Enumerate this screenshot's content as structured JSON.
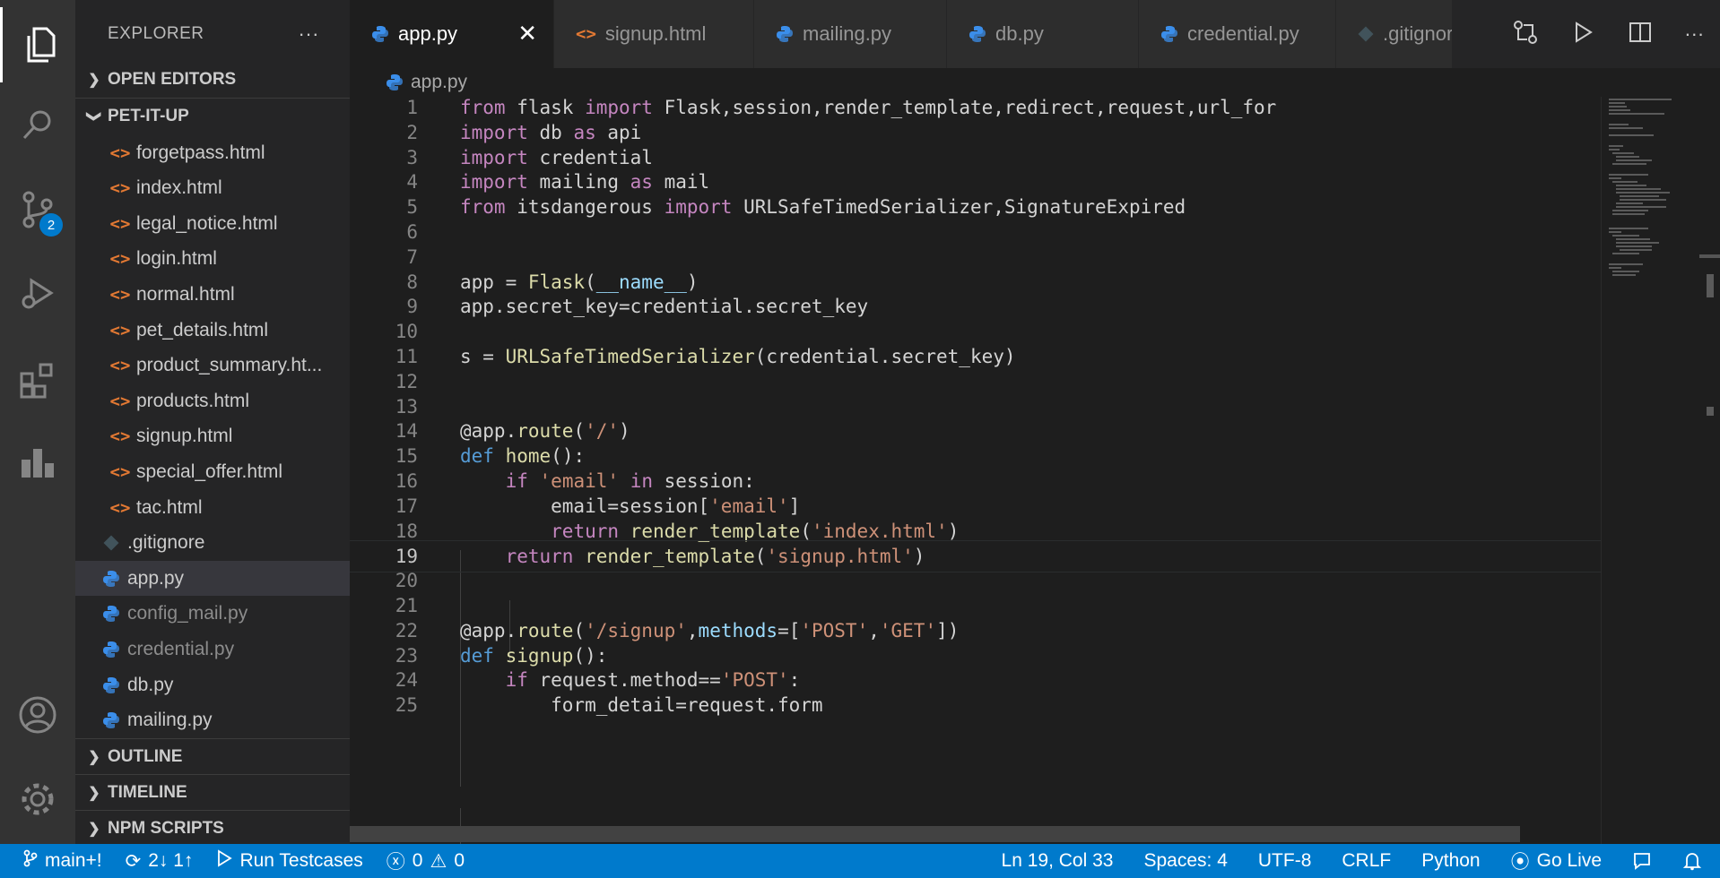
{
  "activity_bar": {
    "scm_badge": "2"
  },
  "sidebar": {
    "title": "EXPLORER",
    "more_label": "···",
    "sections": {
      "open_editors": "OPEN EDITORS",
      "project": "PET-IT-UP",
      "outline": "OUTLINE",
      "timeline": "TIMELINE",
      "npm_scripts": "NPM SCRIPTS"
    },
    "files": [
      {
        "name": "forgetpass.html",
        "icon": "html-icon"
      },
      {
        "name": "index.html",
        "icon": "html-icon"
      },
      {
        "name": "legal_notice.html",
        "icon": "html-icon"
      },
      {
        "name": "login.html",
        "icon": "html-icon"
      },
      {
        "name": "normal.html",
        "icon": "html-icon"
      },
      {
        "name": "pet_details.html",
        "icon": "html-icon"
      },
      {
        "name": "product_summary.ht...",
        "icon": "html-icon"
      },
      {
        "name": "products.html",
        "icon": "html-icon"
      },
      {
        "name": "signup.html",
        "icon": "html-icon"
      },
      {
        "name": "special_offer.html",
        "icon": "html-icon"
      },
      {
        "name": "tac.html",
        "icon": "html-icon"
      },
      {
        "name": ".gitignore",
        "icon": "git-icon"
      },
      {
        "name": "app.py",
        "icon": "python-icon",
        "selected": true
      },
      {
        "name": "config_mail.py",
        "icon": "python-icon",
        "dim": true
      },
      {
        "name": "credential.py",
        "icon": "python-icon",
        "dim": true
      },
      {
        "name": "db.py",
        "icon": "python-icon"
      },
      {
        "name": "mailing.py",
        "icon": "python-icon"
      }
    ]
  },
  "tabs": [
    {
      "label": "app.py",
      "icon": "python-icon",
      "active": true
    },
    {
      "label": "signup.html",
      "icon": "html-icon"
    },
    {
      "label": "mailing.py",
      "icon": "python-icon"
    },
    {
      "label": "db.py",
      "icon": "python-icon"
    },
    {
      "label": "credential.py",
      "icon": "python-icon"
    },
    {
      "label": ".gitignore",
      "icon": "git-icon"
    }
  ],
  "breadcrumb": "app.py",
  "editor": {
    "current_line": 19,
    "lines": [
      {
        "n": "1",
        "text": "from flask import Flask,session,render_template,redirect,request,url_for"
      },
      {
        "n": "2",
        "text": "import db as api"
      },
      {
        "n": "3",
        "text": "import credential"
      },
      {
        "n": "4",
        "text": "import mailing as mail"
      },
      {
        "n": "5",
        "text": "from itsdangerous import URLSafeTimedSerializer,SignatureExpired"
      },
      {
        "n": "6",
        "text": ""
      },
      {
        "n": "7",
        "text": ""
      },
      {
        "n": "8",
        "text": "app = Flask(__name__)"
      },
      {
        "n": "9",
        "text": "app.secret_key=credential.secret_key"
      },
      {
        "n": "10",
        "text": ""
      },
      {
        "n": "11",
        "text": "s = URLSafeTimedSerializer(credential.secret_key)"
      },
      {
        "n": "12",
        "text": ""
      },
      {
        "n": "13",
        "text": ""
      },
      {
        "n": "14",
        "text": "@app.route('/')"
      },
      {
        "n": "15",
        "text": "def home():"
      },
      {
        "n": "16",
        "text": "    if 'email' in session:"
      },
      {
        "n": "17",
        "text": "        email=session['email']"
      },
      {
        "n": "18",
        "text": "        return render_template('index.html')"
      },
      {
        "n": "19",
        "text": "    return render_template('signup.html')"
      },
      {
        "n": "20",
        "text": ""
      },
      {
        "n": "21",
        "text": ""
      },
      {
        "n": "22",
        "text": "@app.route('/signup',methods=['POST','GET'])"
      },
      {
        "n": "23",
        "text": "def signup():"
      },
      {
        "n": "24",
        "text": "    if request.method=='POST':"
      },
      {
        "n": "25",
        "text": "        form_detail=request.form"
      }
    ]
  },
  "status": {
    "branch": "main+!",
    "sync": "2↓ 1↑",
    "run": "Run Testcases",
    "errors": "0",
    "warnings": "0",
    "position": "Ln 19, Col 33",
    "spaces": "Spaces: 4",
    "encoding": "UTF-8",
    "eol": "CRLF",
    "language": "Python",
    "live": "Go Live"
  }
}
